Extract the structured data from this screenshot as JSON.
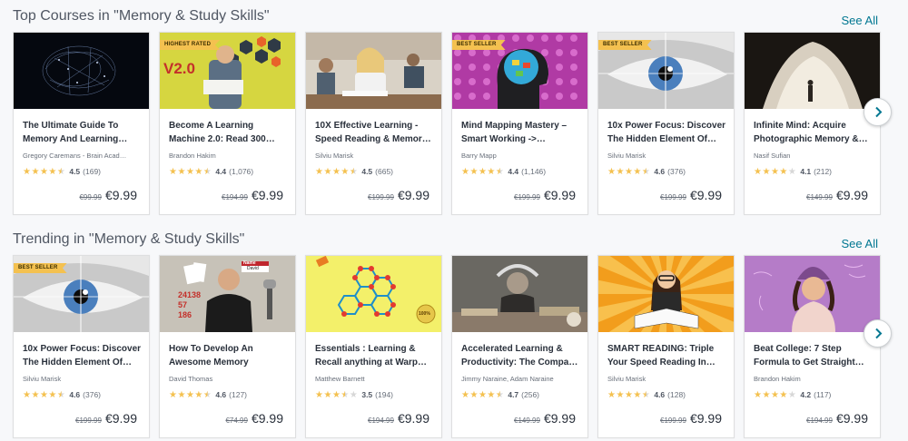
{
  "sections": [
    {
      "title": "Top Courses in \"Memory & Study Skills\"",
      "see_all": "See All",
      "courses": [
        {
          "title1": "The Ultimate Guide To",
          "title2": "Memory And Learning…",
          "author": "Gregory Caremans - Brain Acad…",
          "rating": "4.5",
          "reviews": "(169)",
          "stars": 4.5,
          "old_price": "€99.99",
          "price": "€9.99",
          "badge": "",
          "thumb": "brain"
        },
        {
          "title1": "Become A Learning",
          "title2": "Machine 2.0: Read 300…",
          "author": "Brandon Hakim",
          "rating": "4.4",
          "reviews": "(1,076)",
          "stars": 4.5,
          "old_price": "€194.99",
          "price": "€9.99",
          "badge": "HIGHEST RATED",
          "thumb": "learningmachine"
        },
        {
          "title1": "10X Effective Learning -",
          "title2": "Speed Reading & Memor…",
          "author": "Silviu Marisk",
          "rating": "4.5",
          "reviews": "(665)",
          "stars": 4.5,
          "old_price": "€199.99",
          "price": "€9.99",
          "badge": "",
          "thumb": "classroom"
        },
        {
          "title1": "Mind Mapping Mastery –",
          "title2": "Smart Working ->…",
          "author": "Barry Mapp",
          "rating": "4.4",
          "reviews": "(1,146)",
          "stars": 4.5,
          "old_price": "€199.99",
          "price": "€9.99",
          "badge": "BEST SELLER",
          "thumb": "mindmap"
        },
        {
          "title1": "10x Power Focus: Discover",
          "title2": "The Hidden Element Of…",
          "author": "Silviu Marisk",
          "rating": "4.6",
          "reviews": "(376)",
          "stars": 4.5,
          "old_price": "€199.99",
          "price": "€9.99",
          "badge": "BEST SELLER",
          "thumb": "eye"
        },
        {
          "title1": "Infinite Mind: Acquire",
          "title2": "Photographic Memory &…",
          "author": "Nasif Sufian",
          "rating": "4.1",
          "reviews": "(212)",
          "stars": 4,
          "old_price": "€149.99",
          "price": "€9.99",
          "badge": "",
          "thumb": "cave"
        }
      ]
    },
    {
      "title": "Trending in \"Memory & Study Skills\"",
      "see_all": "See All",
      "courses": [
        {
          "title1": "10x Power Focus: Discover",
          "title2": "The Hidden Element Of…",
          "author": "Silviu Marisk",
          "rating": "4.6",
          "reviews": "(376)",
          "stars": 4.5,
          "old_price": "€199.99",
          "price": "€9.99",
          "badge": "BEST SELLER",
          "thumb": "eye"
        },
        {
          "title1": "How To Develop An",
          "title2": "Awesome Memory",
          "author": "David Thomas",
          "rating": "4.6",
          "reviews": "(127)",
          "stars": 4.5,
          "old_price": "€74.99",
          "price": "€9.99",
          "badge": "",
          "thumb": "david"
        },
        {
          "title1": "Essentials : Learning &",
          "title2": "Recall anything at Warp…",
          "author": "Matthew Barnett",
          "rating": "3.5",
          "reviews": "(194)",
          "stars": 3.5,
          "old_price": "€194.99",
          "price": "€9.99",
          "badge": "",
          "thumb": "hex"
        },
        {
          "title1": "Accelerated Learning &",
          "title2": "Productivity: The Compa…",
          "author": "Jimmy Naraine, Adam Naraine",
          "rating": "4.7",
          "reviews": "(256)",
          "stars": 4.5,
          "old_price": "€149.99",
          "price": "€9.99",
          "badge": "",
          "thumb": "books"
        },
        {
          "title1": "SMART READING: Triple",
          "title2": "Your Speed Reading In…",
          "author": "Silviu Marisk",
          "rating": "4.6",
          "reviews": "(128)",
          "stars": 4.5,
          "old_price": "€199.99",
          "price": "€9.99",
          "badge": "",
          "thumb": "reader"
        },
        {
          "title1": "Beat College: 7 Step",
          "title2": "Formula to Get Straight…",
          "author": "Brandon Hakim",
          "rating": "4.2",
          "reviews": "(117)",
          "stars": 4,
          "old_price": "€194.99",
          "price": "€9.99",
          "badge": "",
          "thumb": "beanie"
        }
      ]
    }
  ],
  "thumb_text": {
    "v2": "V2.0",
    "name_tag": "Name",
    "david_tag": "David",
    "numbers": [
      "24138",
      "57",
      "186"
    ],
    "hundred": "100%"
  },
  "icons": {
    "next": "chevron-right-icon",
    "star": "star-icon"
  },
  "colors": {
    "link": "#007791",
    "star": "#f4c150",
    "badge": "#f4c150"
  }
}
